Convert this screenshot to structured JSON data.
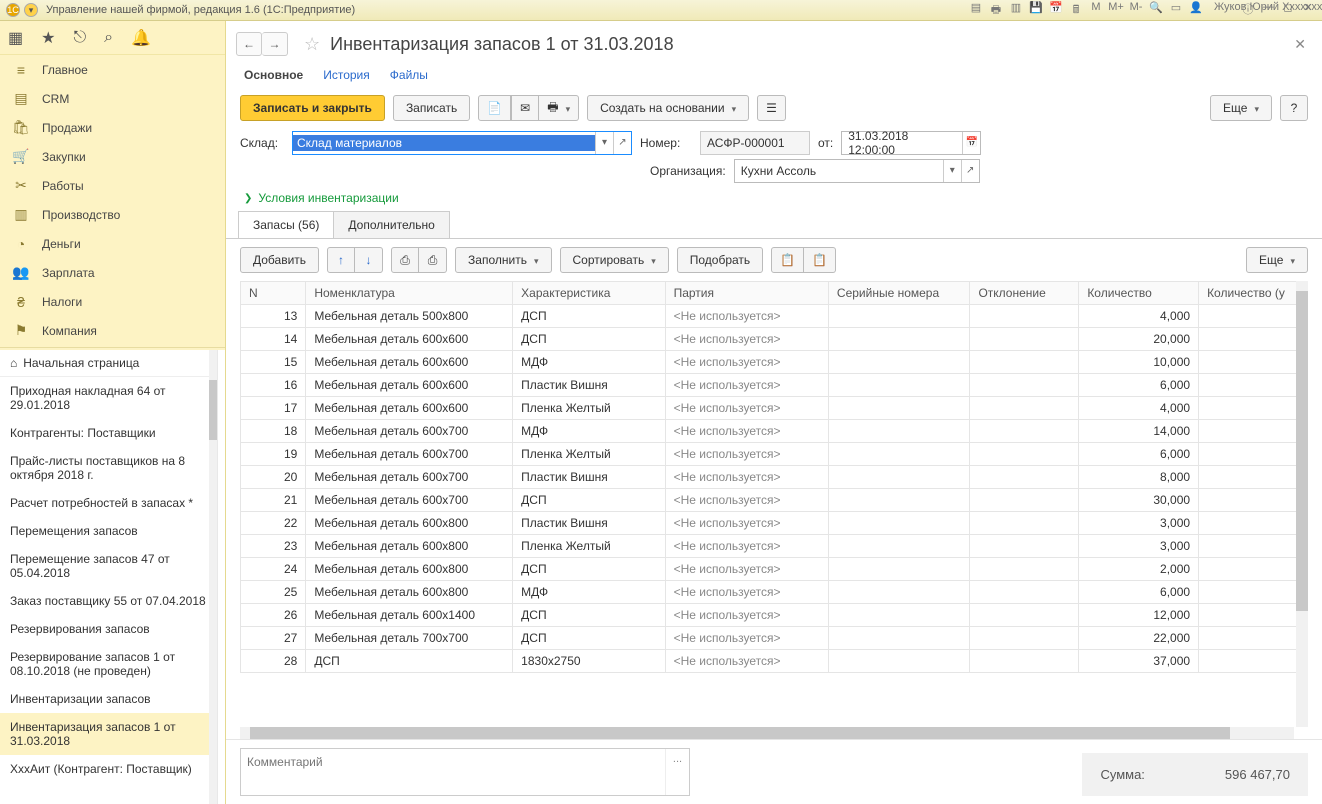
{
  "window": {
    "title": "Управление нашей фирмой, редакция 1.6  (1С:Предприятие)",
    "user": "Жуков Юрий Хххххххххвич"
  },
  "toprow_icons": [
    "▦",
    "★",
    "⎋",
    "⌕",
    "🔔"
  ],
  "nav": [
    {
      "icon": "≡",
      "label": "Главное"
    },
    {
      "icon": "▤",
      "label": "CRM"
    },
    {
      "icon": "🛍",
      "label": "Продажи"
    },
    {
      "icon": "🛒",
      "label": "Закупки"
    },
    {
      "icon": "✂",
      "label": "Работы"
    },
    {
      "icon": "▥",
      "label": "Производство"
    },
    {
      "icon": "◔",
      "label": "Деньги"
    },
    {
      "icon": "👥",
      "label": "Зарплата"
    },
    {
      "icon": "₴",
      "label": "Налоги"
    },
    {
      "icon": "⚑",
      "label": "Компания"
    }
  ],
  "startpage": {
    "icon": "⌂",
    "label": "Начальная страница"
  },
  "history": [
    "Приходная накладная 64 от 29.01.2018",
    "Контрагенты: Поставщики",
    "Прайс-листы поставщиков на 8 октября 2018 г.",
    "Расчет потребностей в запасах *",
    "Перемещения запасов",
    "Перемещение запасов 47 от 05.04.2018",
    "Заказ поставщику 55 от 07.04.2018",
    "Резервирования запасов",
    "Резервирование запасов 1 от 08.10.2018 (не проведен)",
    "Инвентаризации запасов",
    "Инвентаризация запасов 1 от 31.03.2018",
    "ХххАит (Контрагент: Поставщик)"
  ],
  "history_selected_index": 10,
  "doc": {
    "title": "Инвентаризация запасов 1 от 31.03.2018",
    "subtabs": {
      "main": "Основное",
      "history": "История",
      "files": "Файлы"
    },
    "cmds": {
      "save_close": "Записать и закрыть",
      "save": "Записать",
      "based": "Создать на основании",
      "more": "Еще",
      "help": "?"
    },
    "fields": {
      "warehouse_label": "Склад:",
      "warehouse_value": "Склад материалов",
      "number_label": "Номер:",
      "number_value": "АСФР-000001",
      "date_label_from": "от:",
      "date_value": "31.03.2018 12:00:00",
      "org_label": "Организация:",
      "org_value": "Кухни Ассоль"
    },
    "conditions": "Условия инвентаризации",
    "tabs": {
      "stock": "Запасы (56)",
      "extra": "Дополнительно"
    },
    "tabletools": {
      "add": "Добавить",
      "fill": "Заполнить",
      "sort": "Сортировать",
      "pick": "Подобрать",
      "more": "Еще"
    },
    "columns": {
      "n": "N",
      "nom": "Номенклатура",
      "char": "Характеристика",
      "party": "Партия",
      "serial": "Серийные номера",
      "dev": "Отклонение",
      "qty": "Количество",
      "qty2": "Количество (у"
    },
    "not_used": "<Не используется>",
    "rows": [
      {
        "n": 13,
        "nom": "Мебельная деталь 500х800",
        "char": "ДСП",
        "qty": "4,000"
      },
      {
        "n": 14,
        "nom": "Мебельная деталь 600х600",
        "char": "ДСП",
        "qty": "20,000"
      },
      {
        "n": 15,
        "nom": "Мебельная деталь 600х600",
        "char": "МДФ",
        "qty": "10,000"
      },
      {
        "n": 16,
        "nom": "Мебельная деталь 600х600",
        "char": "Пластик Вишня",
        "qty": "6,000"
      },
      {
        "n": 17,
        "nom": "Мебельная деталь 600х600",
        "char": "Пленка Желтый",
        "qty": "4,000"
      },
      {
        "n": 18,
        "nom": "Мебельная деталь 600х700",
        "char": "МДФ",
        "qty": "14,000"
      },
      {
        "n": 19,
        "nom": "Мебельная деталь 600х700",
        "char": "Пленка Желтый",
        "qty": "6,000"
      },
      {
        "n": 20,
        "nom": "Мебельная деталь 600х700",
        "char": "Пластик Вишня",
        "qty": "8,000"
      },
      {
        "n": 21,
        "nom": "Мебельная деталь 600х700",
        "char": "ДСП",
        "qty": "30,000"
      },
      {
        "n": 22,
        "nom": "Мебельная деталь 600х800",
        "char": "Пластик Вишня",
        "qty": "3,000"
      },
      {
        "n": 23,
        "nom": "Мебельная деталь 600х800",
        "char": "Пленка Желтый",
        "qty": "3,000"
      },
      {
        "n": 24,
        "nom": "Мебельная деталь 600х800",
        "char": "ДСП",
        "qty": "2,000"
      },
      {
        "n": 25,
        "nom": "Мебельная деталь 600х800",
        "char": "МДФ",
        "qty": "6,000"
      },
      {
        "n": 26,
        "nom": "Мебельная деталь 600х1400",
        "char": "ДСП",
        "qty": "12,000"
      },
      {
        "n": 27,
        "nom": "Мебельная деталь 700х700",
        "char": "ДСП",
        "qty": "22,000"
      },
      {
        "n": 28,
        "nom": "ДСП",
        "char": "1830х2750",
        "qty": "37,000"
      }
    ],
    "comment_placeholder": "Комментарий",
    "sum": {
      "label": "Сумма:",
      "value": "596 467,70"
    }
  }
}
